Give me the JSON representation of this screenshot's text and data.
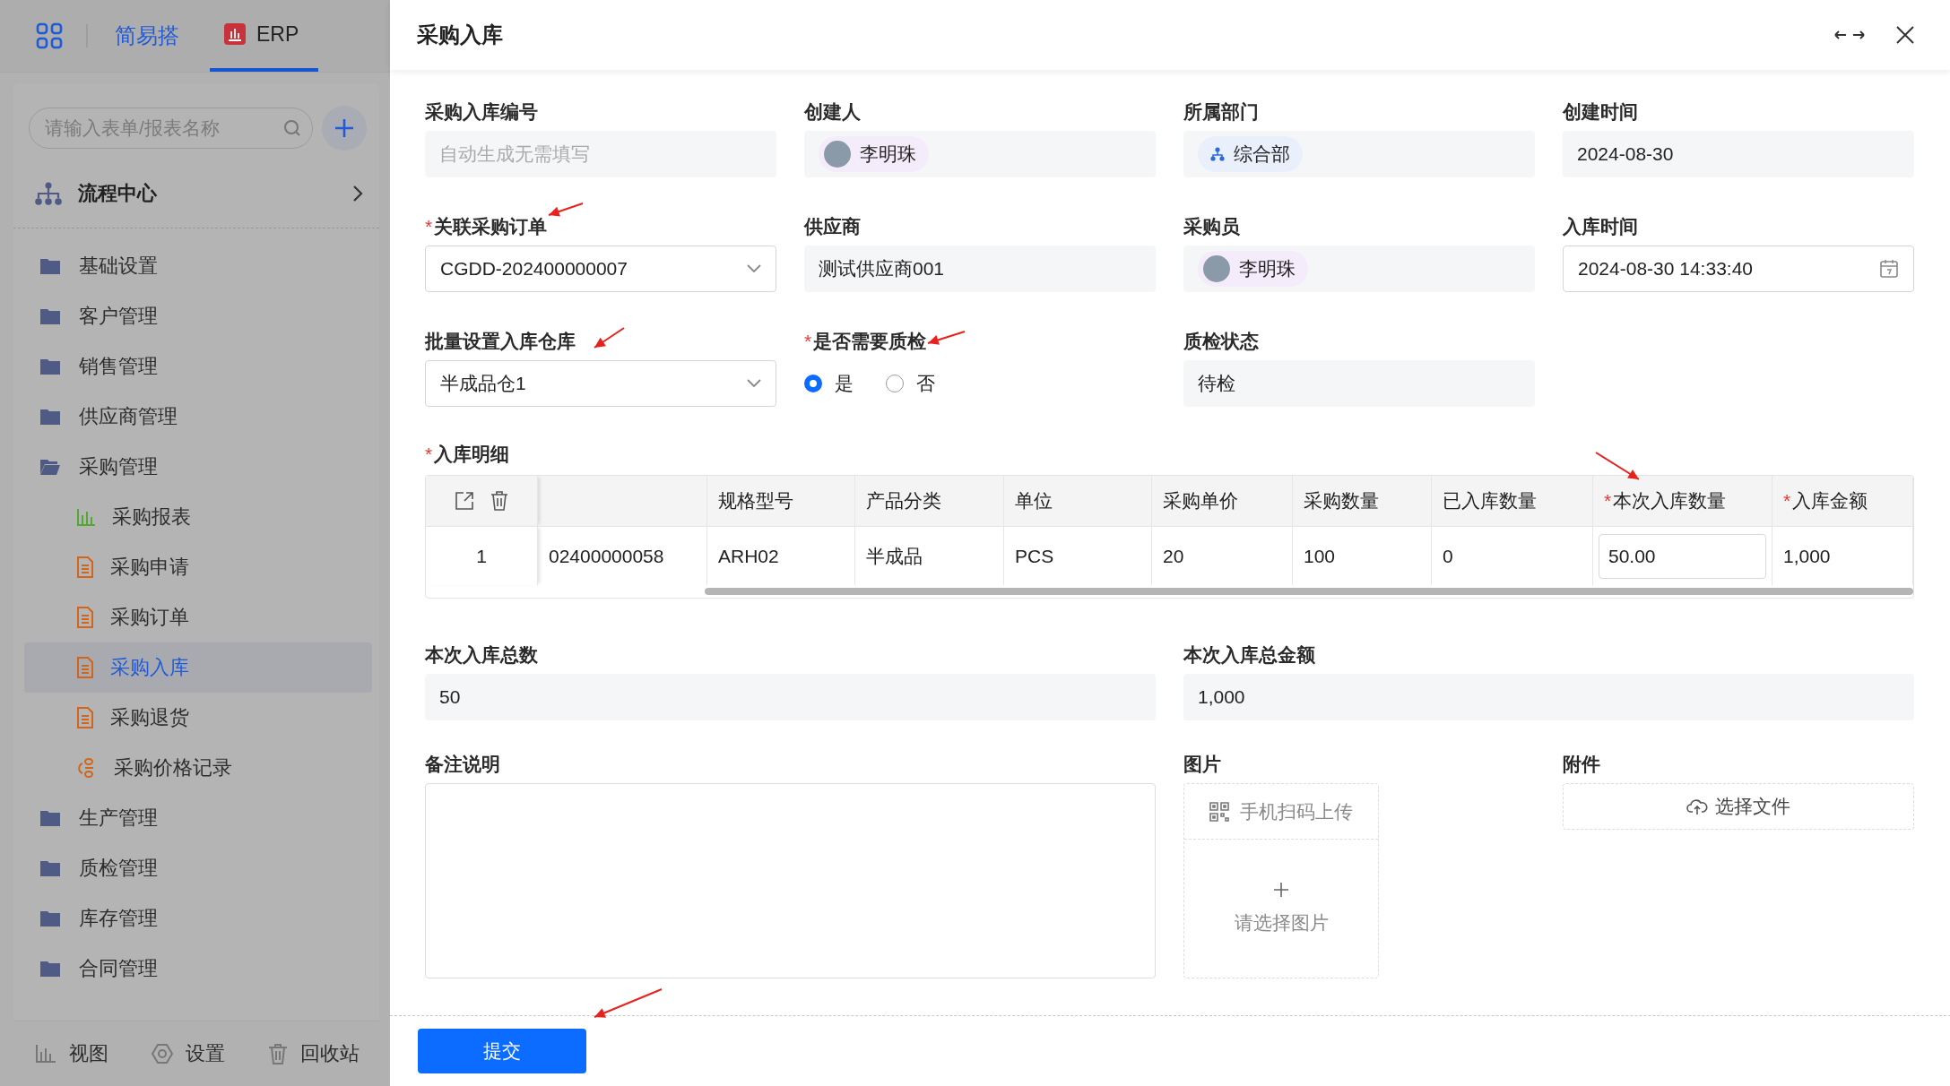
{
  "topbar": {
    "brand": "简易搭",
    "tabs": [
      {
        "label": "ERP",
        "selected": true
      }
    ]
  },
  "sidebar": {
    "search": {
      "placeholder": "请输入表单/报表名称"
    },
    "process_center": {
      "label": "流程中心"
    },
    "items": [
      {
        "label": "基础设置",
        "kind": "folder",
        "expanded": false
      },
      {
        "label": "客户管理",
        "kind": "folder",
        "expanded": false
      },
      {
        "label": "销售管理",
        "kind": "folder",
        "expanded": false
      },
      {
        "label": "供应商管理",
        "kind": "folder",
        "expanded": false
      },
      {
        "label": "采购管理",
        "kind": "folder",
        "expanded": true,
        "children": [
          {
            "label": "采购报表",
            "kind": "report",
            "selected": false
          },
          {
            "label": "采购申请",
            "kind": "form",
            "selected": false
          },
          {
            "label": "采购订单",
            "kind": "form",
            "selected": false
          },
          {
            "label": "采购入库",
            "kind": "form",
            "selected": true
          },
          {
            "label": "采购退货",
            "kind": "form",
            "selected": false
          },
          {
            "label": "采购价格记录",
            "kind": "record",
            "selected": false
          }
        ]
      },
      {
        "label": "生产管理",
        "kind": "folder",
        "expanded": false
      },
      {
        "label": "质检管理",
        "kind": "folder",
        "expanded": false
      },
      {
        "label": "库存管理",
        "kind": "folder",
        "expanded": false
      },
      {
        "label": "合同管理",
        "kind": "folder",
        "expanded": false
      }
    ],
    "footer": [
      {
        "label": "视图",
        "kind": "view"
      },
      {
        "label": "设置",
        "kind": "settings"
      },
      {
        "label": "回收站",
        "kind": "trash"
      }
    ]
  },
  "drawer": {
    "title": "采购入库",
    "fields": [
      {
        "label": "采购入库编号",
        "kind": "placeholder",
        "placeholder": "自动生成无需填写"
      },
      {
        "label": "创建人",
        "kind": "user",
        "value": "李明珠"
      },
      {
        "label": "所属部门",
        "kind": "dept",
        "value": "综合部"
      },
      {
        "label": "创建时间",
        "kind": "text",
        "value": "2024-08-30"
      },
      {
        "required_mark": "*",
        "label": "关联采购订单",
        "kind": "select",
        "value": "CGDD-202400000007"
      },
      {
        "label": "供应商",
        "kind": "text",
        "value": "测试供应商001"
      },
      {
        "label": "采购员",
        "kind": "user",
        "value": "李明珠"
      },
      {
        "label": "入库时间",
        "kind": "datetime",
        "value": "2024-08-30 14:33:40"
      },
      {
        "label": "批量设置入库仓库",
        "kind": "select",
        "value": "半成品仓1"
      },
      {
        "required_mark": "*",
        "label": "是否需要质检",
        "kind": "radio",
        "options": [
          {
            "label": "是",
            "selected": true
          },
          {
            "label": "否",
            "selected": false
          }
        ]
      },
      {
        "label": "质检状态",
        "kind": "text",
        "value": "待检"
      }
    ],
    "detail": {
      "required_mark": "*",
      "label": "入库明细",
      "columns": [
        {
          "kind": "text"
        },
        {
          "label": "规格型号",
          "kind": "text"
        },
        {
          "label": "产品分类",
          "kind": "text"
        },
        {
          "label": "单位",
          "kind": "text"
        },
        {
          "label": "采购单价",
          "kind": "text"
        },
        {
          "label": "采购数量",
          "kind": "text"
        },
        {
          "label": "已入库数量",
          "kind": "text"
        },
        {
          "required_mark": "*",
          "label": "本次入库数量",
          "kind": "input"
        },
        {
          "required_mark": "*",
          "label": "入库金额",
          "kind": "text"
        }
      ],
      "rows": [
        {
          "index": "1",
          "cells": [
            "02400000058",
            "ARH02",
            "半成品",
            "PCS",
            "20",
            "100",
            "0",
            "50.00",
            "1,000"
          ]
        }
      ]
    },
    "summary": [
      {
        "label": "本次入库总数",
        "kind": "text",
        "value": "50"
      },
      {
        "label": "本次入库总金额",
        "kind": "text",
        "value": "1,000"
      }
    ],
    "extras": [
      {
        "label": "备注说明",
        "kind": "textarea"
      },
      {
        "label": "图片",
        "kind": "image",
        "scan_label": "手机扫码上传",
        "hint": "请选择图片"
      },
      {
        "label": "附件",
        "kind": "file",
        "button": "选择文件"
      }
    ],
    "submit": "提交"
  }
}
